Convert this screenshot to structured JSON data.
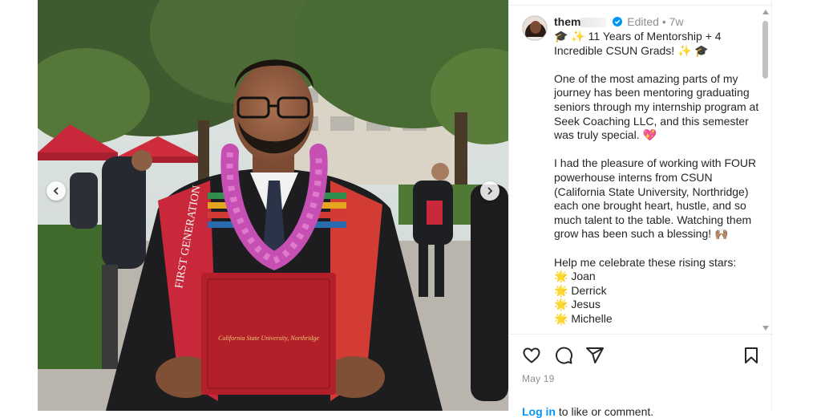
{
  "post": {
    "username": "them",
    "edited": "Edited",
    "separator": "•",
    "age": "7w",
    "date": "May 19",
    "login_link": "Log in",
    "login_suffix": "to like or comment."
  },
  "caption": {
    "title_line": "🎓 ✨ 11 Years of Mentorship + 4 Incredible CSUN Grads! ✨ 🎓",
    "para1": "One of the most amazing parts of my journey has been mentoring graduating seniors through my internship program at Seek Coaching LLC, and this semester was truly special. 💖",
    "para2": "I had the pleasure of working with FOUR powerhouse interns from CSUN (California State University, Northridge) each one brought heart, hustle, and so much talent to the table. Watching them grow has been such a blessing! 🙌🏽",
    "para3": "Help me celebrate these rising stars:",
    "stars": [
      "Joan",
      "Derrick",
      "Jesus",
      "Michelle"
    ],
    "star_emoji": "🌟"
  },
  "photo": {
    "diploma_text": "California State University, Northridge",
    "stole_text": "FIRST GENERATION"
  },
  "colors": {
    "accent": "#0095f6",
    "verified": "#0095f6",
    "text": "#262626",
    "muted": "#8e8e8e",
    "diploma": "#b3202a",
    "lei": "#c64fb3"
  }
}
